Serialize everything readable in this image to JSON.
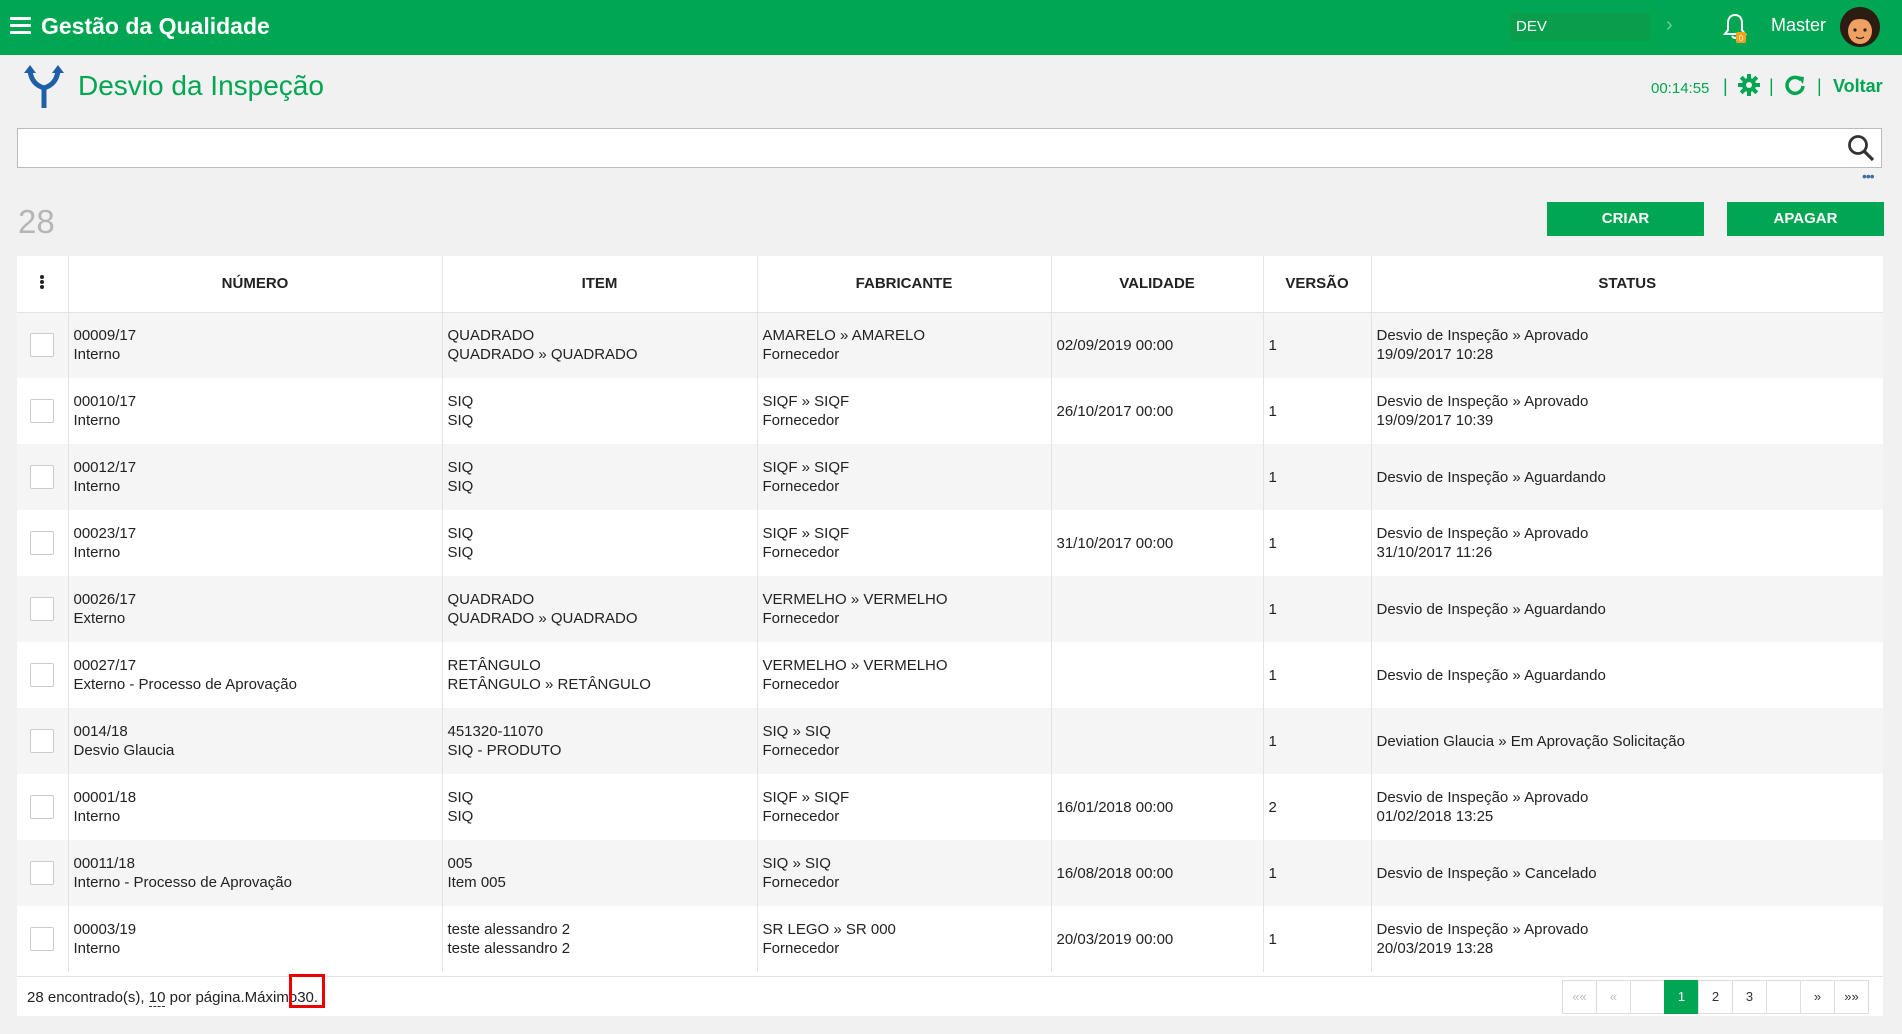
{
  "header": {
    "app_title": "Gestão da Qualidade",
    "environment": "DEV",
    "notification_count": "0",
    "user_name": "Master"
  },
  "page": {
    "title": "Desvio da Inspeção",
    "timer": "00:14:55",
    "back_label": "Voltar"
  },
  "search": {
    "value": "",
    "placeholder": ""
  },
  "record_count": "28",
  "actions": {
    "create_label": "CRIAR",
    "delete_label": "APAGAR"
  },
  "table": {
    "columns": [
      "NÚMERO",
      "ITEM",
      "FABRICANTE",
      "VALIDADE",
      "VERSÃO",
      "STATUS"
    ],
    "rows": [
      {
        "numero_1": "00009/17",
        "numero_2": "Interno",
        "item_1": "QUADRADO",
        "item_2": "QUADRADO » QUADRADO",
        "fab_1": "AMARELO » AMARELO",
        "fab_2": "Fornecedor",
        "validade": "02/09/2019 00:00",
        "versao": "1",
        "status_1": "Desvio de Inspeção » Aprovado",
        "status_2": "19/09/2017 10:28"
      },
      {
        "numero_1": "00010/17",
        "numero_2": "Interno",
        "item_1": "SIQ",
        "item_2": "SIQ",
        "fab_1": "SIQF » SIQF",
        "fab_2": "Fornecedor",
        "validade": "26/10/2017 00:00",
        "versao": "1",
        "status_1": "Desvio de Inspeção » Aprovado",
        "status_2": "19/09/2017 10:39"
      },
      {
        "numero_1": "00012/17",
        "numero_2": "Interno",
        "item_1": "SIQ",
        "item_2": "SIQ",
        "fab_1": "SIQF » SIQF",
        "fab_2": "Fornecedor",
        "validade": "",
        "versao": "1",
        "status_1": "Desvio de Inspeção » Aguardando",
        "status_2": ""
      },
      {
        "numero_1": "00023/17",
        "numero_2": "Interno",
        "item_1": "SIQ",
        "item_2": "SIQ",
        "fab_1": "SIQF » SIQF",
        "fab_2": "Fornecedor",
        "validade": "31/10/2017 00:00",
        "versao": "1",
        "status_1": "Desvio de Inspeção » Aprovado",
        "status_2": "31/10/2017 11:26"
      },
      {
        "numero_1": "00026/17",
        "numero_2": "Externo",
        "item_1": "QUADRADO",
        "item_2": "QUADRADO » QUADRADO",
        "fab_1": "VERMELHO » VERMELHO",
        "fab_2": "Fornecedor",
        "validade": "",
        "versao": "1",
        "status_1": "Desvio de Inspeção » Aguardando",
        "status_2": ""
      },
      {
        "numero_1": "00027/17",
        "numero_2": "Externo - Processo de Aprovação",
        "item_1": "RETÂNGULO",
        "item_2": "RETÂNGULO » RETÂNGULO",
        "fab_1": "VERMELHO » VERMELHO",
        "fab_2": "Fornecedor",
        "validade": "",
        "versao": "1",
        "status_1": "Desvio de Inspeção » Aguardando",
        "status_2": ""
      },
      {
        "numero_1": "0014/18",
        "numero_2": "Desvio Glaucia",
        "item_1": "451320-11070",
        "item_2": "SIQ - PRODUTO",
        "fab_1": "SIQ » SIQ",
        "fab_2": "Fornecedor",
        "validade": "",
        "versao": "1",
        "status_1": "Deviation Glaucia » Em Aprovação Solicitação",
        "status_2": ""
      },
      {
        "numero_1": "00001/18",
        "numero_2": "Interno",
        "item_1": "SIQ",
        "item_2": "SIQ",
        "fab_1": "SIQF » SIQF",
        "fab_2": "Fornecedor",
        "validade": "16/01/2018 00:00",
        "versao": "2",
        "status_1": "Desvio de Inspeção » Aprovado",
        "status_2": "01/02/2018 13:25"
      },
      {
        "numero_1": "00011/18",
        "numero_2": "Interno - Processo de Aprovação",
        "item_1": "005",
        "item_2": "Item 005",
        "fab_1": "SIQ » SIQ",
        "fab_2": "Fornecedor",
        "validade": "16/08/2018 00:00",
        "versao": "1",
        "status_1": "Desvio de Inspeção » Cancelado",
        "status_2": ""
      },
      {
        "numero_1": "00003/19",
        "numero_2": "Interno",
        "item_1": "teste alessandro 2",
        "item_2": "teste alessandro 2",
        "fab_1": "SR LEGO » SR 000",
        "fab_2": "Fornecedor",
        "validade": "20/03/2019 00:00",
        "versao": "1",
        "status_1": "Desvio de Inspeção » Aprovado",
        "status_2": "20/03/2019 13:28"
      }
    ]
  },
  "footer": {
    "found_text": "28 encontrado(s),",
    "per_page_value": "10",
    "per_page_text": "por página.Máximo",
    "max_value": "30."
  },
  "pagination": {
    "first": "««",
    "prev": "«",
    "pages": [
      "1",
      "2",
      "3"
    ],
    "active_page": "1",
    "next": "»",
    "last": "»»"
  },
  "colors": {
    "brand": "#00a651",
    "highlight": "#ee0000"
  }
}
